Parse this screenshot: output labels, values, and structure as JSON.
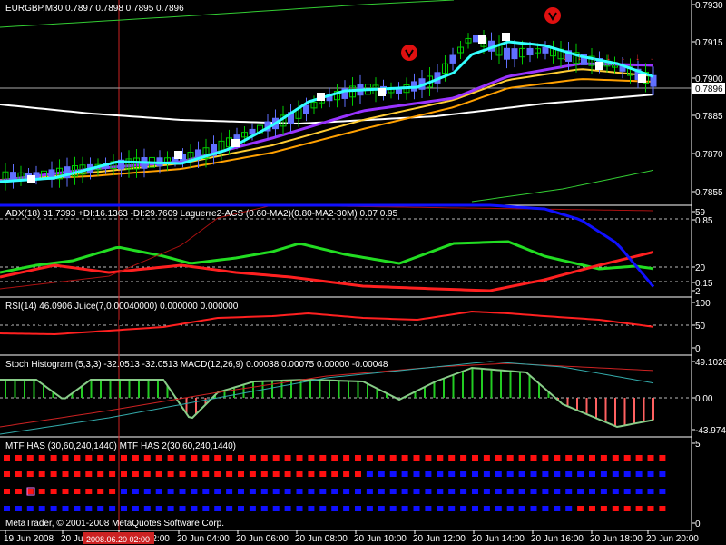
{
  "main": {
    "header": "EURGBP,M30  0.7897 0.7898 0.7895 0.7896",
    "current_price": "0.7896",
    "y_ticks": [
      "0.7930",
      "0.7915",
      "0.7900",
      "0.7885",
      "0.7870",
      "0.7855"
    ]
  },
  "adx": {
    "header": "ADX(18) 31.7393 +DI:16.1363 -DI:29.7609  Laguerre2-ACS (0.60-MA2)(0.80-MA2-30M)  0.07 0.95",
    "y_ticks": [
      "59",
      "0.85",
      "20",
      "0.15",
      "2"
    ]
  },
  "rsi": {
    "header": "RSI(14) 46.0906  Juice(7,0.00040000) 0.000000 0.000000",
    "y_ticks": [
      "100",
      "50",
      "0"
    ]
  },
  "stoch": {
    "header": "Stoch Histogram (5,3,3) -32.0513 -32.0513  MACD(12,26,9) 0.00038 0.00075 0.00000 -0.00048",
    "y_ticks": [
      "49.1026",
      "0.00",
      "-43.9744"
    ]
  },
  "mtf": {
    "header": "MTF HAS (30,60,240,1440)  MTF HAS 2(30,60,240,1440)",
    "y_ticks": [
      "5",
      "0"
    ],
    "rows": [
      {
        "colors": "RRRRRRRRRRRRRRRRRRRRRRRRRRRRRRRRRRRRRRRRRRRRRRRRRRRRRRRRR"
      },
      {
        "colors": "RRRRRRRRRRRRRRRRRRRRRRRRRRRRRRRBBBBBBBBBBBBBBBBBBBBBBBBBB"
      },
      {
        "colors": "RRRRRRRRRRBBBBBBBBBBBBBBBBBBBBBBBBBBBBBBBBBBBBBBBBBBBBBBB"
      },
      {
        "colors": "BBBBBBBBBBBBBBBBBBBBBBBBBBBBBBBBBBBBBBBBBBBBBBBBBRRRRRRRR"
      }
    ]
  },
  "copyright": "MetaTrader, © 2001-2008 MetaQuotes Software Corp.",
  "time_axis": {
    "cursor_label": "2008.06.20 02:00",
    "labels": [
      "19 Jun 2008",
      "20 Jun 00:00",
      "20 Jun 02:00",
      "20 Jun 04:00",
      "20 Jun 06:00",
      "20 Jun 08:00",
      "20 Jun 10:00",
      "20 Jun 12:00",
      "20 Jun 14:00",
      "20 Jun 16:00",
      "20 Jun 18:00",
      "20 Jun 20:00"
    ]
  },
  "colors": {
    "background": "#000000",
    "grid": "#ffffff",
    "bull": "#00cc00",
    "bear": "#ffffff",
    "cyan": "#33ffff",
    "purple": "#9933ff",
    "orange": "#ffa000",
    "white_ma": "#ffffff",
    "green_ma": "#33cc33",
    "red": "#ff2020",
    "blue": "#1010ff",
    "cursor": "#cc2222"
  }
}
